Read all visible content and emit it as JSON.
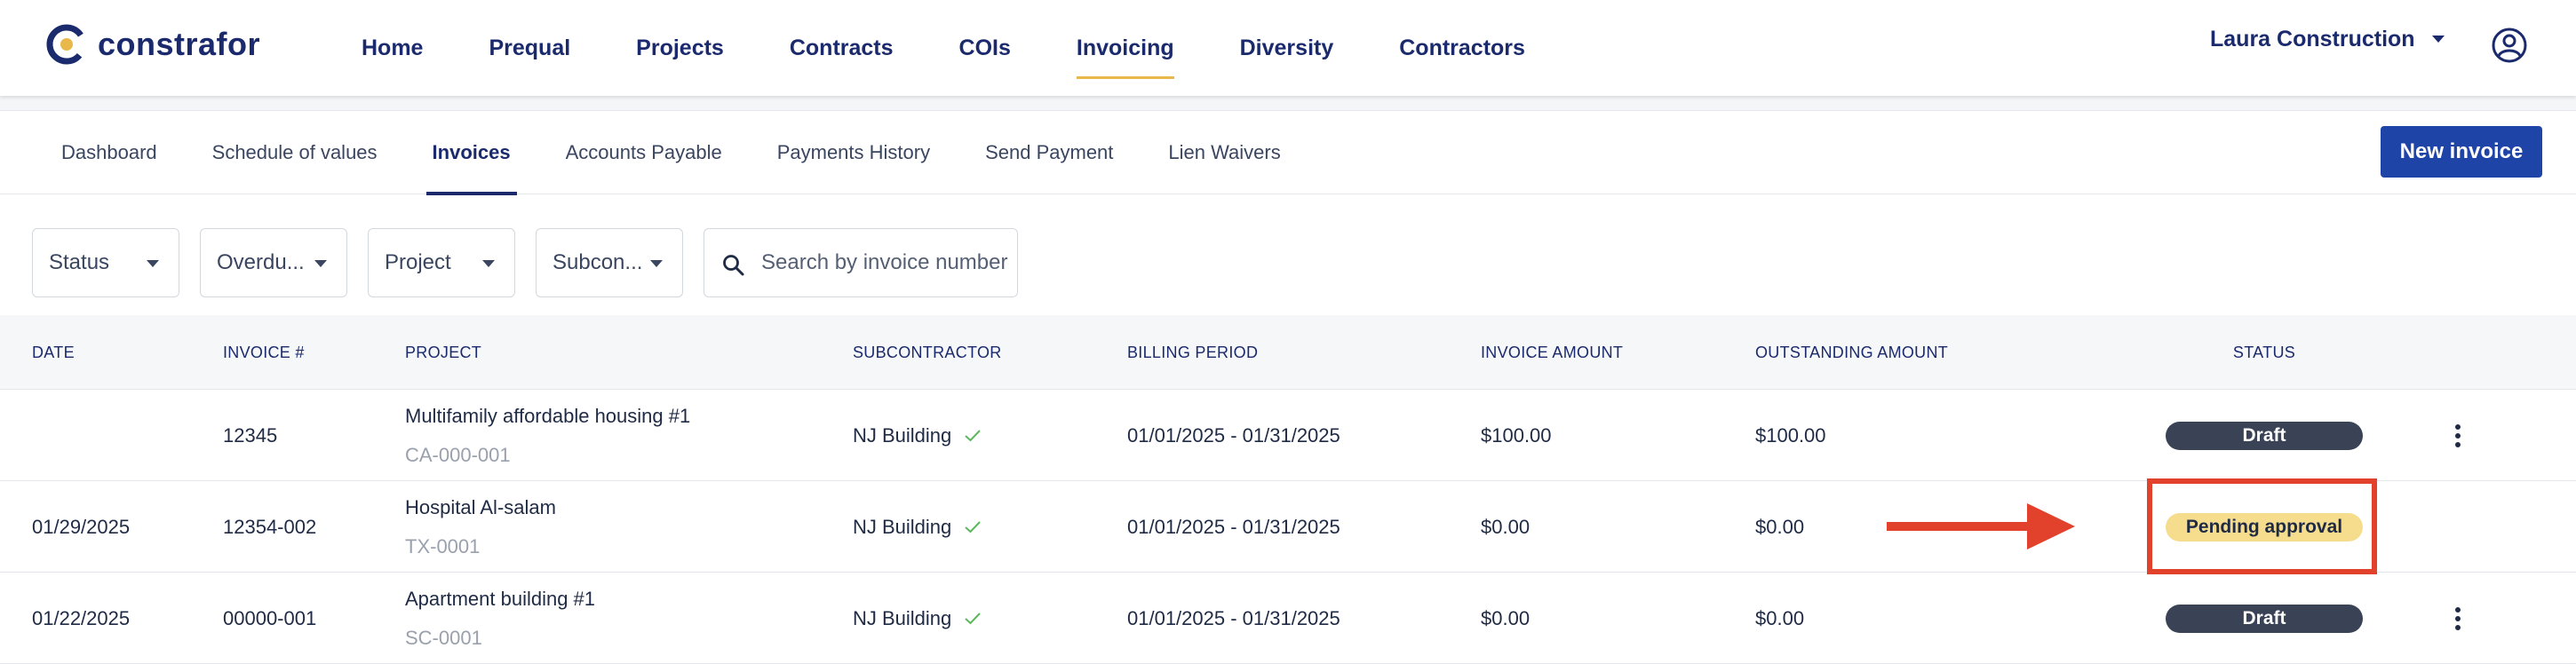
{
  "brand": {
    "name": "constrafor",
    "accent": "#e8b84a",
    "primary": "#1a2a6c",
    "button": "#1e44a8"
  },
  "nav": {
    "items": [
      {
        "label": "Home",
        "active": false
      },
      {
        "label": "Prequal",
        "active": false
      },
      {
        "label": "Projects",
        "active": false
      },
      {
        "label": "Contracts",
        "active": false
      },
      {
        "label": "COIs",
        "active": false
      },
      {
        "label": "Invoicing",
        "active": true
      },
      {
        "label": "Diversity",
        "active": false
      },
      {
        "label": "Contractors",
        "active": false
      }
    ]
  },
  "account": {
    "company": "Laura Construction",
    "profile_icon": "user-circle-icon"
  },
  "subnav": {
    "items": [
      {
        "label": "Dashboard",
        "active": false
      },
      {
        "label": "Schedule of values",
        "active": false
      },
      {
        "label": "Invoices",
        "active": true
      },
      {
        "label": "Accounts Payable",
        "active": false
      },
      {
        "label": "Payments History",
        "active": false
      },
      {
        "label": "Send Payment",
        "active": false
      },
      {
        "label": "Lien Waivers",
        "active": false
      }
    ],
    "new_invoice_label": "New invoice"
  },
  "filters": {
    "status": "Status",
    "overdue": "Overdu...",
    "project": "Project",
    "subcontractor": "Subcon...",
    "search_placeholder": "Search by invoice number"
  },
  "table": {
    "headers": {
      "date": "DATE",
      "invoice": "INVOICE #",
      "project": "PROJECT",
      "subcontractor": "SUBCONTRACTOR",
      "billing_period": "BILLING PERIOD",
      "invoice_amount": "INVOICE AMOUNT",
      "outstanding_amount": "OUTSTANDING AMOUNT",
      "status": "STATUS"
    },
    "rows": [
      {
        "date": "",
        "invoice": "12345",
        "project_name": "Multifamily affordable housing #1",
        "project_code": "CA-000-001",
        "subcontractor": "NJ Building",
        "billing_period": "01/01/2025 - 01/31/2025",
        "invoice_amount": "$100.00",
        "outstanding_amount": "$100.00",
        "status": "Draft"
      },
      {
        "date": "01/29/2025",
        "invoice": "12354-002",
        "project_name": "Hospital Al-salam",
        "project_code": "TX-0001",
        "subcontractor": "NJ Building",
        "billing_period": "01/01/2025 - 01/31/2025",
        "invoice_amount": "$0.00",
        "outstanding_amount": "$0.00",
        "status": "Pending approval"
      },
      {
        "date": "01/22/2025",
        "invoice": "00000-001",
        "project_name": "Apartment building #1",
        "project_code": "SC-0001",
        "subcontractor": "NJ Building",
        "billing_period": "01/01/2025 - 01/31/2025",
        "invoice_amount": "$0.00",
        "outstanding_amount": "$0.00",
        "status": "Draft"
      }
    ]
  },
  "colors": {
    "draft_badge": "#3a4256",
    "pending_badge": "#f6dd8e",
    "annotation": "#e2412b",
    "verified_check": "#5cb85c"
  }
}
